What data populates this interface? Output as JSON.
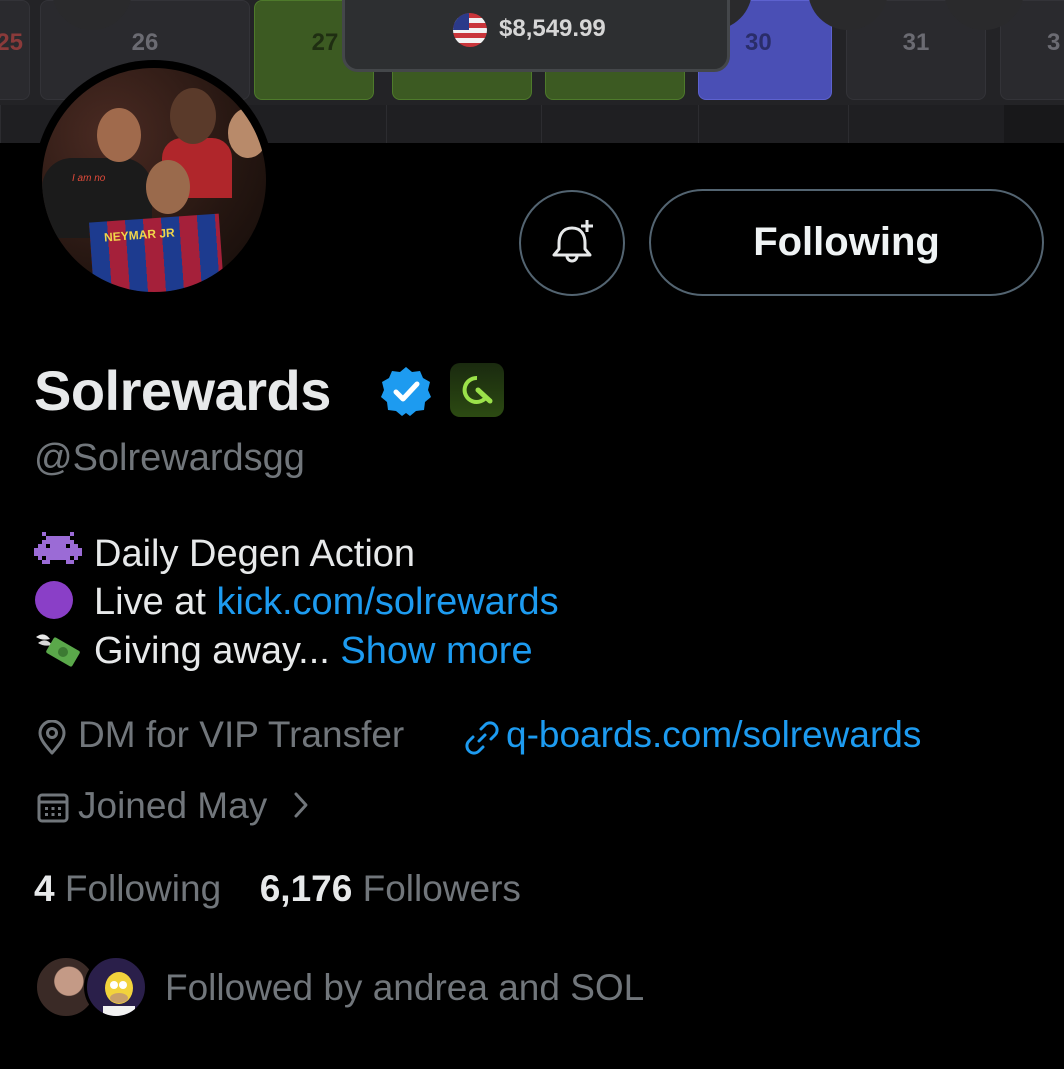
{
  "banner": {
    "calendar_cells": [
      "25",
      "26",
      "27",
      "30",
      "31",
      "3"
    ],
    "balance": "$8,549.99"
  },
  "avatar": {
    "jersey_text": "NEYMAR JR",
    "shirt_text": "I am no"
  },
  "actions": {
    "notify_icon": "bell-plus-icon",
    "following_label": "Following"
  },
  "profile": {
    "name": "Solrewards",
    "handle": "@Solrewardsgg",
    "verified_color": "#1d9bf0",
    "bio": {
      "line1_text": "Daily Degen Action",
      "line2_text": "Live at ",
      "line2_link": "kick.com/solrewards",
      "line3_text": "Giving away...",
      "show_more": "Show more"
    },
    "location": "DM for VIP Transfer",
    "website": "q-boards.com/solrewards",
    "joined": "Joined May"
  },
  "stats": {
    "following_count": "4",
    "following_label": "Following",
    "followers_count": "6,176",
    "followers_label": "Followers"
  },
  "followed_by": {
    "text": "Followed by andrea and SOL"
  },
  "colors": {
    "background": "#000000",
    "text_primary": "#e7e9ea",
    "text_secondary": "#71767b",
    "link": "#1d9bf0",
    "border": "#536471"
  }
}
